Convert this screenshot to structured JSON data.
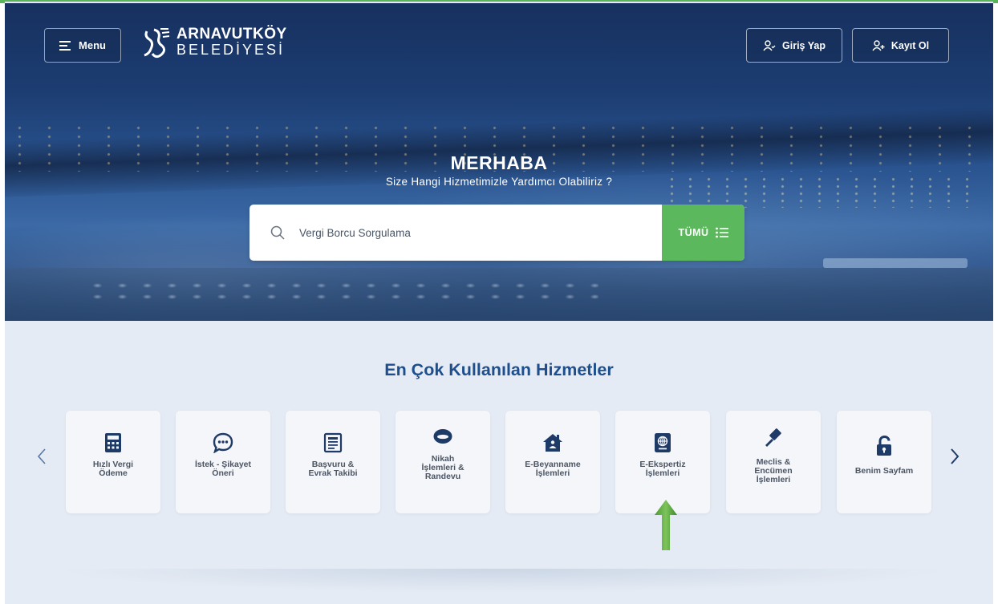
{
  "header": {
    "menu_label": "Menu",
    "logo_line1": "ARNAVUTKÖY",
    "logo_line2": "BELEDİYESİ",
    "login_label": "Giriş Yap",
    "register_label": "Kayıt Ol"
  },
  "hero": {
    "title": "MERHABA",
    "subtitle": "Size Hangi Hizmetimizle Yardımcı Olabiliriz ?"
  },
  "search": {
    "placeholder": "Vergi Borcu Sorgulama",
    "all_label": "TÜMÜ"
  },
  "services": {
    "title": "En Çok Kullanılan Hizmetler",
    "items": [
      {
        "label": "Hızlı Vergi\nÖdeme",
        "icon": "calculator-icon"
      },
      {
        "label": "İstek - Şikayet\nÖneri",
        "icon": "chat-bubble-icon"
      },
      {
        "label": "Başvuru &\nEvrak Takibi",
        "icon": "document-icon"
      },
      {
        "label": "Nikah\nİşlemleri &\nRandevu",
        "icon": "ring-icon"
      },
      {
        "label": "E-Beyanname\nİşlemleri",
        "icon": "house-icon"
      },
      {
        "label": "E-Ekspertiz\nİşlemleri",
        "icon": "passport-icon"
      },
      {
        "label": "Meclis &\nEncümen\nİşlemleri",
        "icon": "gavel-icon"
      },
      {
        "label": "Benim Sayfam",
        "icon": "unlock-icon"
      }
    ]
  },
  "colors": {
    "accent_green": "#5cb85c",
    "title_blue": "#1d4f8e",
    "icon_navy": "#1e3a66"
  }
}
